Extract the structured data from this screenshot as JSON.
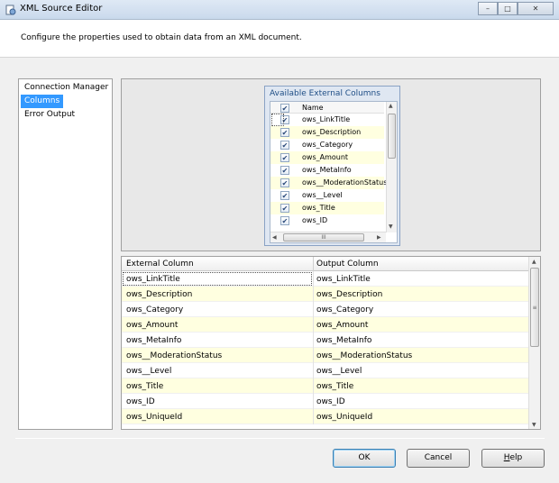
{
  "window": {
    "title": "XML Source Editor",
    "controls": {
      "minimize": "–",
      "maximize": "□",
      "close": "✕"
    }
  },
  "header": {
    "description": "Configure the properties used to obtain data from an XML document."
  },
  "nav": {
    "items": [
      {
        "label": "Connection Manager",
        "selected": false
      },
      {
        "label": "Columns",
        "selected": true
      },
      {
        "label": "Error Output",
        "selected": false
      }
    ]
  },
  "available_columns": {
    "title": "Available External Columns",
    "header": "Name",
    "items": [
      "ows_LinkTitle",
      "ows_Description",
      "ows_Category",
      "ows_Amount",
      "ows_MetaInfo",
      "ows__ModerationStatus",
      "ows__Level",
      "ows_Title",
      "ows_ID"
    ],
    "check_mark": "✔",
    "hscroll_grip": "III",
    "arrows": {
      "up": "▲",
      "down": "▼",
      "left": "◀",
      "right": "▶"
    }
  },
  "grid": {
    "headers": [
      "External Column",
      "Output Column"
    ],
    "rows": [
      [
        "ows_LinkTitle",
        "ows_LinkTitle"
      ],
      [
        "ows_Description",
        "ows_Description"
      ],
      [
        "ows_Category",
        "ows_Category"
      ],
      [
        "ows_Amount",
        "ows_Amount"
      ],
      [
        "ows_MetaInfo",
        "ows_MetaInfo"
      ],
      [
        "ows__ModerationStatus",
        "ows__ModerationStatus"
      ],
      [
        "ows__Level",
        "ows__Level"
      ],
      [
        "ows_Title",
        "ows_Title"
      ],
      [
        "ows_ID",
        "ows_ID"
      ],
      [
        "ows_UniqueId",
        "ows_UniqueId"
      ]
    ],
    "vscroll_grip": "≡"
  },
  "buttons": {
    "ok": "OK",
    "cancel": "Cancel",
    "help_first": "H",
    "help_rest": "elp"
  },
  "colors": {
    "selection": "#3399ff",
    "alt_row": "#ffffe0",
    "group_header": "#1f4e86"
  }
}
